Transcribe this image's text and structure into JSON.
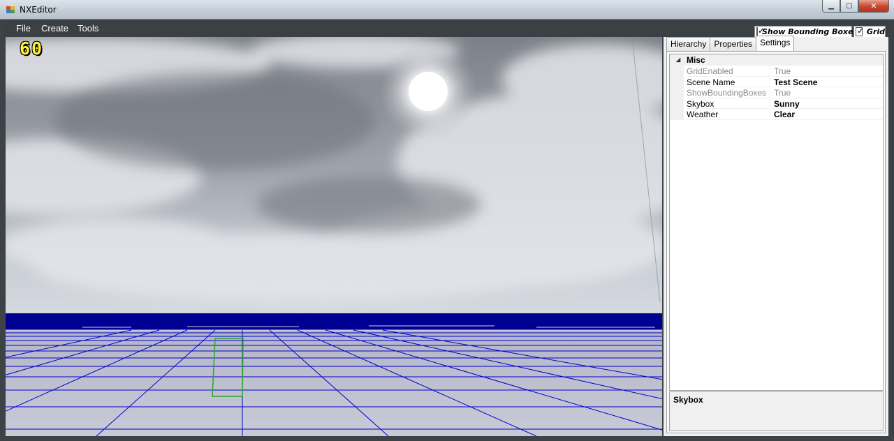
{
  "window": {
    "title": "NXEditor",
    "controls": {
      "minimize_icon": "minimize-icon",
      "maximize_icon": "maximize-icon",
      "close_icon": "close-icon"
    }
  },
  "menu": {
    "items": [
      {
        "label": "File"
      },
      {
        "label": "Create"
      },
      {
        "label": "Tools"
      }
    ]
  },
  "toolbar": {
    "show_bounding_boxes": {
      "label": "Show Bounding Boxes",
      "checked": true
    },
    "grid": {
      "label": "Grid",
      "checked": true
    }
  },
  "viewport": {
    "fps": "60",
    "sky_color": "#a8acb4",
    "ocean_color": "#000093",
    "grid_color": "#0000cc",
    "bounding_box_color": "#2aa52a"
  },
  "side_panel": {
    "tabs": [
      {
        "label": "Hierarchy",
        "active": false
      },
      {
        "label": "Properties",
        "active": false
      },
      {
        "label": "Settings",
        "active": true
      }
    ],
    "category": "Misc",
    "properties": [
      {
        "name": "GridEnabled",
        "value": "True",
        "state": "readonly"
      },
      {
        "name": "Scene Name",
        "value": "Test Scene",
        "state": "set"
      },
      {
        "name": "ShowBoundingBoxes",
        "value": "True",
        "state": "readonly"
      },
      {
        "name": "Skybox",
        "value": "Sunny",
        "state": "set"
      },
      {
        "name": "Weather",
        "value": "Clear",
        "state": "set"
      }
    ],
    "help_title": "Skybox"
  }
}
